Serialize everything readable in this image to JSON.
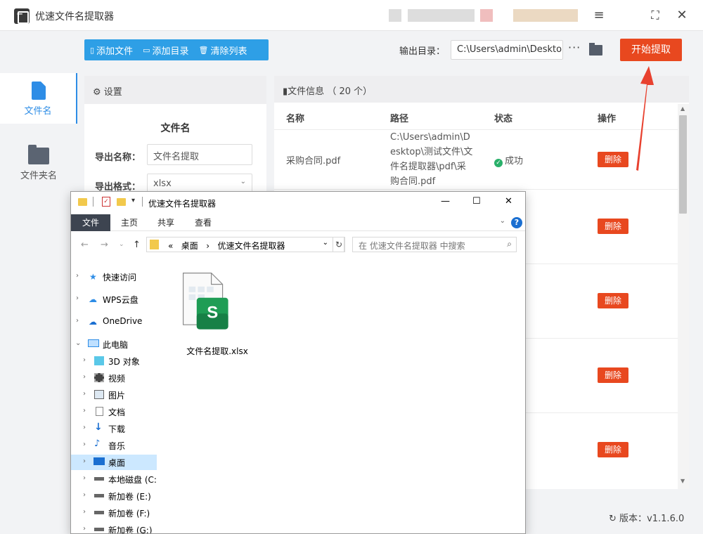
{
  "app": {
    "title": "优速文件名提取器",
    "version_label": "版本：",
    "version": "v1.1.6.0"
  },
  "sidebar": {
    "items": [
      {
        "label": "文件名"
      },
      {
        "label": "文件夹名"
      }
    ]
  },
  "toolbar": {
    "add_file": "添加文件",
    "add_dir": "添加目录",
    "clear_list": "清除列表",
    "output_label": "输出目录：",
    "output_value": "C:\\Users\\admin\\Desktop",
    "more": "···",
    "start": "开始提取"
  },
  "settings": {
    "header": "设置",
    "section": "文件名",
    "export_name_label": "导出名称：",
    "export_name_value": "文件名提取",
    "export_format_label": "导出格式：",
    "export_format_value": "xlsx"
  },
  "fileinfo": {
    "header": "文件信息",
    "count": "（ 20 个）",
    "columns": [
      "名称",
      "路径",
      "状态",
      "操作"
    ],
    "rows": [
      {
        "name": "采购合同.pdf",
        "path": "C:\\Users\\admin\\Desktop\\测试文件\\文件名提取器\\pdf\\采购合同.pdf",
        "status": "成功",
        "action": "删除"
      },
      {
        "action": "删除"
      },
      {
        "action": "删除"
      },
      {
        "action": "删除"
      },
      {
        "action": "删除"
      }
    ]
  },
  "explorer": {
    "title": "优速文件名提取器",
    "tabs": [
      "文件",
      "主页",
      "共享",
      "查看"
    ],
    "breadcrumb": [
      "«",
      "桌面",
      "›",
      "优速文件名提取器"
    ],
    "search_placeholder": "在 优速文件名提取器 中搜索",
    "nav": [
      {
        "label": "快速访问",
        "icon": "star-icon"
      },
      {
        "label": "WPS云盘",
        "icon": "cloud-icon"
      },
      {
        "label": "OneDrive",
        "icon": "cloud-icon"
      },
      {
        "label": "此电脑",
        "icon": "computer-icon"
      },
      {
        "label": "3D 对象",
        "icon": "cube-icon"
      },
      {
        "label": "视频",
        "icon": "video-icon"
      },
      {
        "label": "图片",
        "icon": "picture-icon"
      },
      {
        "label": "文档",
        "icon": "document-icon"
      },
      {
        "label": "下载",
        "icon": "download-icon"
      },
      {
        "label": "音乐",
        "icon": "music-icon"
      },
      {
        "label": "桌面",
        "icon": "desktop-icon"
      },
      {
        "label": "本地磁盘 (C:",
        "icon": "drive-icon"
      },
      {
        "label": "新加卷 (E:)",
        "icon": "drive-icon"
      },
      {
        "label": "新加卷 (F:)",
        "icon": "drive-icon"
      },
      {
        "label": "新加卷 (G:)",
        "icon": "drive-icon"
      }
    ],
    "file": {
      "name": "文件名提取.xlsx",
      "badge": "S"
    }
  },
  "colors": {
    "accent": "#2e8de6",
    "danger": "#e8481f",
    "toolbar": "#2e9fe6",
    "success": "#29b06a",
    "sheet_green": "#1f9d55"
  }
}
